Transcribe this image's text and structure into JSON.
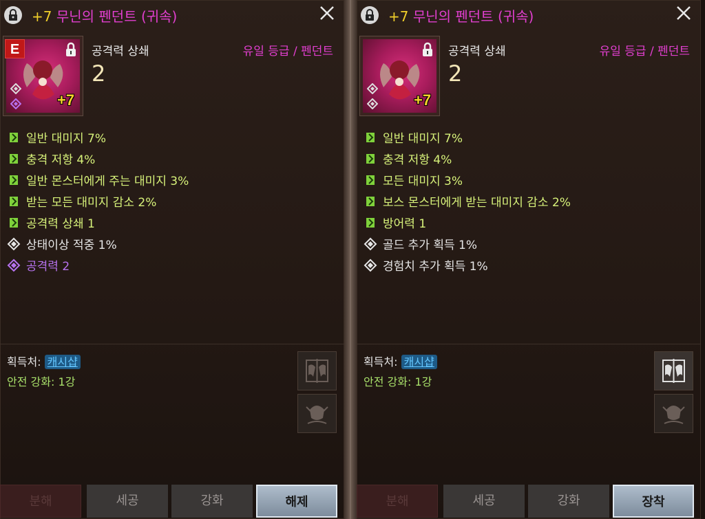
{
  "panels": [
    {
      "title_plus": "+7",
      "title_name": "무닌의 펜던트 (귀속)",
      "grade_badge": "E",
      "enhance": "+7",
      "stat_name": "공격력 상쇄",
      "stat_value": "2",
      "grade": "유일 등급 / 펜던트",
      "options": [
        {
          "icon": "green-rune-icon",
          "text": "일반 대미지 7%"
        },
        {
          "icon": "green-rune-icon",
          "text": "충격 저항 4%"
        },
        {
          "icon": "green-rune-icon",
          "text": "일반 몬스터에게 주는 대미지 3%"
        },
        {
          "icon": "green-rune-icon",
          "text": "받는 모든 대미지 감소 2%"
        },
        {
          "icon": "green-rune-icon",
          "text": "공격력 상쇄 1"
        },
        {
          "icon": "white-diamond-icon",
          "text": "상태이상 적중 1%"
        },
        {
          "icon": "purple-diamond-icon",
          "text": "공격력 2"
        }
      ],
      "source_label": "획득처:",
      "source_value": "캐시샵",
      "safe_enhance": "안전 강화: 1강",
      "buttons": [
        "분해",
        "세공",
        "강화",
        "해제"
      ]
    },
    {
      "title_plus": "+7",
      "title_name": "무닌의 펜던트 (귀속)",
      "grade_badge": "",
      "enhance": "+7",
      "stat_name": "공격력 상쇄",
      "stat_value": "2",
      "grade": "유일 등급 / 펜던트",
      "options": [
        {
          "icon": "green-rune-icon",
          "text": "일반 대미지 7%"
        },
        {
          "icon": "green-rune-icon",
          "text": "충격 저항 4%"
        },
        {
          "icon": "green-rune-icon",
          "text": "모든 대미지 3%"
        },
        {
          "icon": "green-rune-icon",
          "text": "보스 몬스터에게 받는 대미지 감소 2%"
        },
        {
          "icon": "green-rune-icon",
          "text": "방어력 1"
        },
        {
          "icon": "white-diamond-icon",
          "text": "골드 추가 획득 1%"
        },
        {
          "icon": "white-diamond-icon",
          "text": "경험치 추가 획득 1%"
        }
      ],
      "source_label": "획득처:",
      "source_value": "캐시샵",
      "safe_enhance": "안전 강화: 1강",
      "buttons": [
        "분해",
        "세공",
        "강화",
        "장착"
      ]
    }
  ],
  "colors": {
    "title": "#e23fd0",
    "enhance": "#f0cf2a",
    "option_green": "#d7f27a",
    "option_purple": "#b672ee",
    "link": "#63c6ff"
  }
}
